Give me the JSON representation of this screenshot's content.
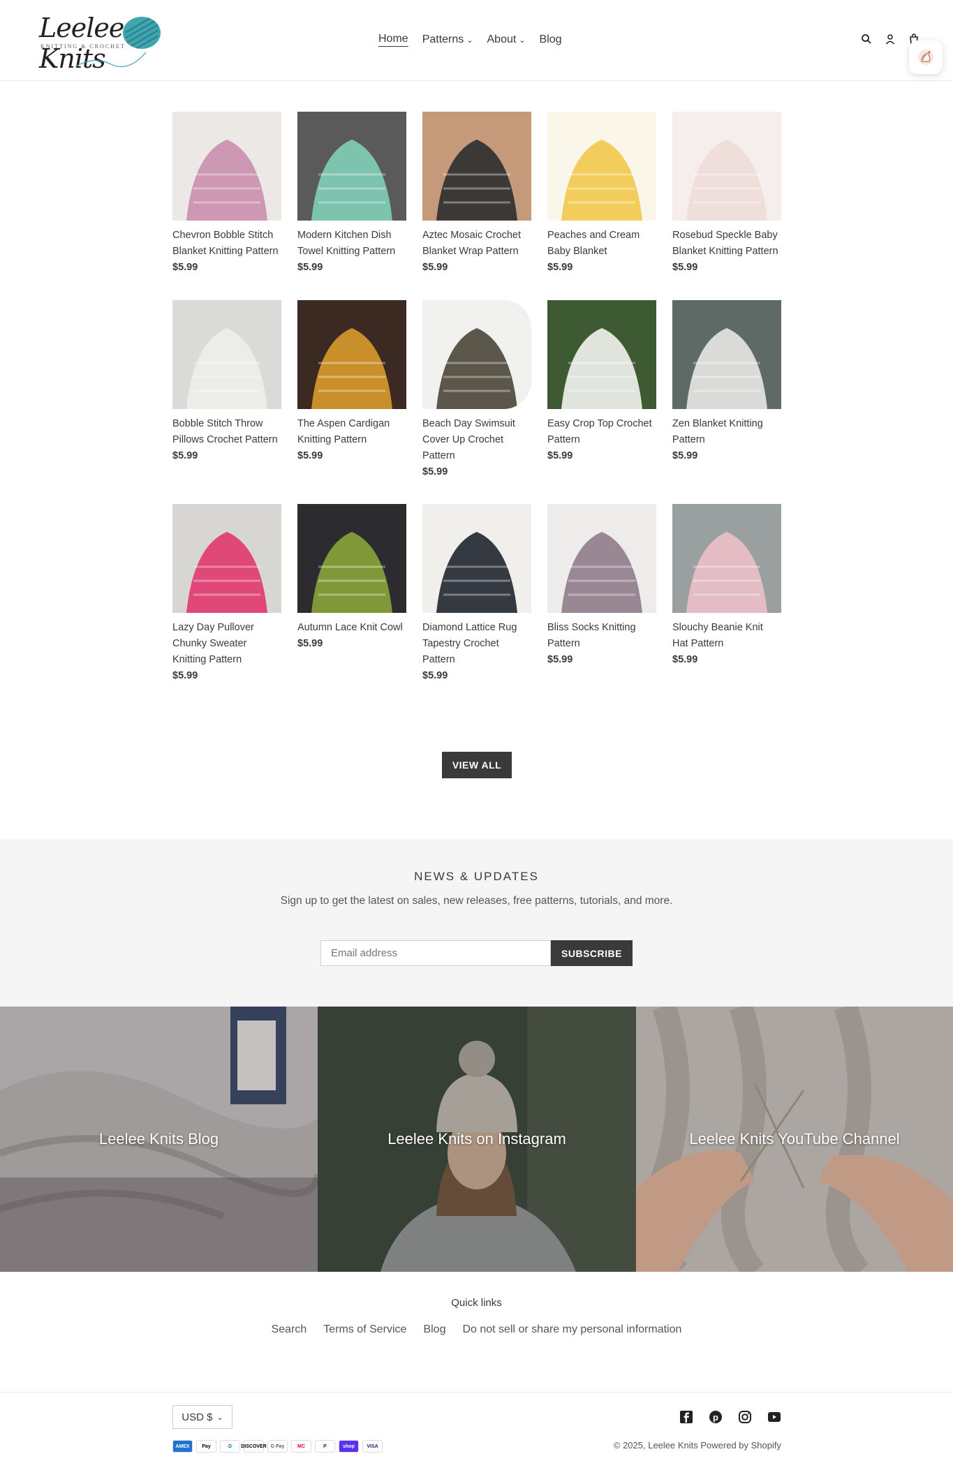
{
  "header": {
    "logo_text": "Leelee Knits",
    "logo_subtext": "KNITTING & CROCHET",
    "nav": [
      {
        "label": "Home",
        "active": true,
        "dropdown": false
      },
      {
        "label": "Patterns",
        "active": false,
        "dropdown": true
      },
      {
        "label": "About",
        "active": false,
        "dropdown": true
      },
      {
        "label": "Blog",
        "active": false,
        "dropdown": false
      }
    ],
    "icons": [
      "search-icon",
      "account-icon",
      "cart-icon"
    ]
  },
  "products": [
    {
      "title": "Chevron Bobble Stitch Blanket Knitting Pattern",
      "price": "$5.99",
      "color": "#c98fae",
      "bg": "#ece8e6"
    },
    {
      "title": "Modern Kitchen Dish Towel Knitting Pattern",
      "price": "$5.99",
      "color": "#7fcfb6",
      "bg": "#5a5a5a"
    },
    {
      "title": "Aztec Mosaic Crochet Blanket Wrap Pattern",
      "price": "$5.99",
      "color": "#2e2e2e",
      "bg": "#c49a7a"
    },
    {
      "title": "Peaches and Cream Baby Blanket",
      "price": "$5.99",
      "color": "#f2c94c",
      "bg": "#fbf6ea"
    },
    {
      "title": "Rosebud Speckle Baby Blanket Knitting Pattern",
      "price": "$5.99",
      "color": "#f0dcd8",
      "bg": "#f6eeec"
    },
    {
      "title": "Bobble Stitch Throw Pillows Crochet Pattern",
      "price": "$5.99",
      "color": "#ededeb",
      "bg": "#dadad8"
    },
    {
      "title": "The Aspen Cardigan Knitting Pattern",
      "price": "$5.99",
      "color": "#d99a2b",
      "bg": "#3b2a22"
    },
    {
      "title": "Beach Day Swimsuit Cover Up Crochet Pattern",
      "price": "$5.99",
      "color": "#4a4638",
      "bg": "#f1f1ef"
    },
    {
      "title": "Easy Crop Top Crochet Pattern",
      "price": "$5.99",
      "color": "#f3f3f0",
      "bg": "#3d5a33"
    },
    {
      "title": "Zen Blanket Knitting Pattern",
      "price": "$5.99",
      "color": "#e8e8e6",
      "bg": "#5d6a66"
    },
    {
      "title": "Lazy Day Pullover Chunky Sweater Knitting Pattern",
      "price": "$5.99",
      "color": "#e0386e",
      "bg": "#d8d6d2"
    },
    {
      "title": "Autumn Lace Knit Cowl",
      "price": "$5.99",
      "color": "#8aa43a",
      "bg": "#2b2b30"
    },
    {
      "title": "Diamond Lattice Rug Tapestry Crochet Pattern",
      "price": "$5.99",
      "color": "#1f2530",
      "bg": "#f0efec"
    },
    {
      "title": "Bliss Socks Knitting Pattern",
      "price": "$5.99",
      "color": "#8f7d8a",
      "bg": "#eeeceb"
    },
    {
      "title": "Slouchy Beanie Knit Hat Pattern",
      "price": "$5.99",
      "color": "#ecc0c8",
      "bg": "#9aa0a0"
    }
  ],
  "view_all_label": "VIEW ALL",
  "newsletter": {
    "heading": "NEWS & UPDATES",
    "subtext": "Sign up to get the latest on sales, new releases, free patterns, tutorials, and more.",
    "email_placeholder": "Email address",
    "button_label": "SUBSCRIBE"
  },
  "features": [
    {
      "label": "Leelee Knits Blog",
      "bg": "#9c9a9b"
    },
    {
      "label": "Leelee Knits on Instagram",
      "bg": "#55534f"
    },
    {
      "label": "Leelee Knits YouTube Channel",
      "bg": "#a59f99"
    }
  ],
  "footer": {
    "quick_links_heading": "Quick links",
    "links": [
      "Search",
      "Terms of Service",
      "Blog",
      "Do not sell or share my personal information"
    ],
    "currency": "USD $",
    "social": [
      "facebook-icon",
      "pinterest-icon",
      "instagram-icon",
      "youtube-icon"
    ],
    "payments": [
      "AMEX",
      "Pay",
      "D",
      "DISCOVER",
      "G Pay",
      "MC",
      "P",
      "shop",
      "VISA"
    ],
    "copyright": "© 2025, Leelee Knits Powered by Shopify"
  },
  "colors": {
    "accent": "#3a3a3a",
    "logo_teal": "#3fa5ae",
    "light_bg": "#f5f5f5"
  }
}
